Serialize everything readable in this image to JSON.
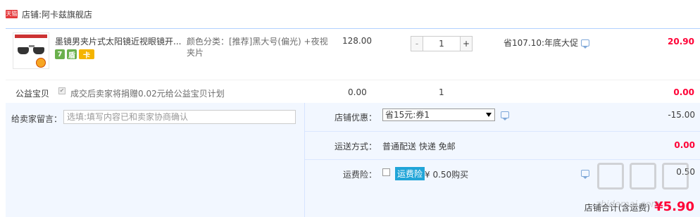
{
  "shop": {
    "badge": "天猫",
    "prefix": "店铺:",
    "name": "阿卡兹旗舰店"
  },
  "item": {
    "title": "墨镜男夹片式太阳镜近视眼镜开...",
    "sku": "颜色分类：[推荐]黑大号(偏光) +夜视夹片",
    "price": "128.00",
    "quantity": "1",
    "promo": "省107.10:年底大促",
    "total": "20.90",
    "service_icons": [
      "7",
      "盾",
      "卡"
    ]
  },
  "charity": {
    "label": "公益宝贝",
    "text": "成交后卖家将捐赠0.02元给公益宝贝计划",
    "price": "0.00",
    "qty": "1",
    "total": "0.00"
  },
  "message": {
    "label": "给卖家留言：",
    "placeholder": "选填:填写内容已和卖家协商确认"
  },
  "shop_discount": {
    "label": "店铺优惠：",
    "selected": "省15元:券1",
    "value": "-15.00"
  },
  "shipping": {
    "label": "运送方式：",
    "method": "普通配送 快递 免邮",
    "fee": "0.00"
  },
  "insurance": {
    "label": "运费险：",
    "tag": "运费险",
    "price": "¥ 0.50购买",
    "fee": "0.50"
  },
  "shop_total": {
    "label": "店铺合计(含运费)",
    "value": "¥5.90"
  },
  "watermark": {
    "url": "zhidemai.com"
  },
  "colors": {
    "accent": "#ff0036",
    "panel": "#f2f7ff",
    "border": "#b2d1ff",
    "tmall": "#e4393c"
  }
}
